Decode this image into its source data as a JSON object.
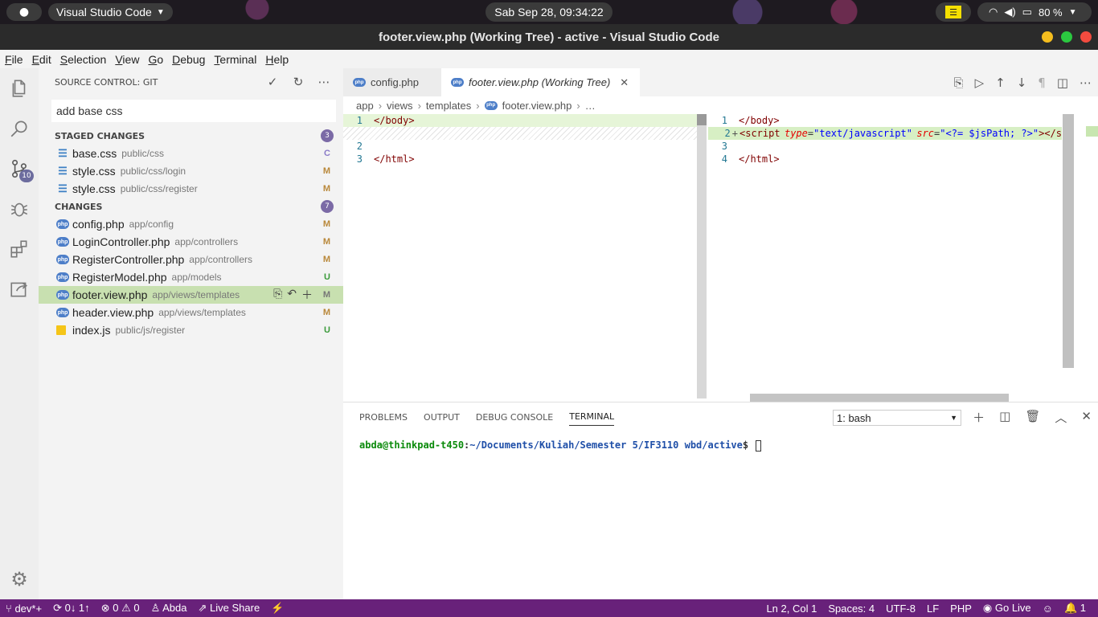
{
  "system": {
    "app_name": "Visual Studio Code",
    "clock": "Sab Sep 28, 09:34:22",
    "battery": "80 %"
  },
  "window": {
    "title": "footer.view.php (Working Tree) - active - Visual Studio Code"
  },
  "menu": [
    "File",
    "Edit",
    "Selection",
    "View",
    "Go",
    "Debug",
    "Terminal",
    "Help"
  ],
  "activity": {
    "scm_badge": "10"
  },
  "sidebar": {
    "title": "SOURCE CONTROL: GIT",
    "commit_message": "add base css",
    "staged_header": "STAGED CHANGES",
    "staged_count": "3",
    "staged": [
      {
        "name": "base.css",
        "path": "public/css",
        "status": "C",
        "icon": "css-icon"
      },
      {
        "name": "style.css",
        "path": "public/css/login",
        "status": "M",
        "icon": "css-icon"
      },
      {
        "name": "style.css",
        "path": "public/css/register",
        "status": "M",
        "icon": "css-icon"
      }
    ],
    "changes_header": "CHANGES",
    "changes_count": "7",
    "changes": [
      {
        "name": "config.php",
        "path": "app/config",
        "status": "M"
      },
      {
        "name": "LoginController.php",
        "path": "app/controllers",
        "status": "M"
      },
      {
        "name": "RegisterController.php",
        "path": "app/controllers",
        "status": "M"
      },
      {
        "name": "RegisterModel.php",
        "path": "app/models",
        "status": "U"
      },
      {
        "name": "footer.view.php",
        "path": "app/views/templates",
        "status": "M"
      },
      {
        "name": "header.view.php",
        "path": "app/views/templates",
        "status": "M"
      },
      {
        "name": "index.js",
        "path": "public/js/register",
        "status": "U"
      }
    ]
  },
  "tabs": [
    {
      "label": "config.php"
    },
    {
      "label": "footer.view.php (Working Tree)"
    }
  ],
  "breadcrumb": [
    "app",
    "views",
    "templates",
    "footer.view.php",
    "…"
  ],
  "diff": {
    "left": {
      "l1": "1",
      "l1_code": "</body>",
      "l2": "2",
      "l3": "3",
      "l3_code": "</html>"
    },
    "right": {
      "l1": "1",
      "l1_code": "</body>",
      "l2": "2",
      "l2_tag": "script",
      "l2_attr1": "type",
      "l2_val1": "\"text/javascript\"",
      "l2_attr2": "src",
      "l2_val2": "\"<?= $jsPath; ?>\"",
      "l2_tail": "></s",
      "l3": "3",
      "l4": "4",
      "l4_code": "</html>"
    }
  },
  "panel": {
    "tabs": [
      "PROBLEMS",
      "OUTPUT",
      "DEBUG CONSOLE",
      "TERMINAL"
    ],
    "terminal_select": "1: bash",
    "prompt_user": "abda@thinkpad-t450",
    "prompt_sep": ":",
    "prompt_path": "~/Documents/Kuliah/Semester 5/IF3110 wbd/active",
    "prompt_end": "$"
  },
  "status": {
    "branch": "dev*+",
    "sync": "0↓ 1↑",
    "errors": "0",
    "warnings": "0",
    "user": "Abda",
    "live_share": "Live Share",
    "position": "Ln 2, Col 1",
    "spaces": "Spaces: 4",
    "encoding": "UTF-8",
    "eol": "LF",
    "language": "PHP",
    "go_live": "Go Live",
    "notifications": "1"
  },
  "colors": {
    "status_bar": "#68217a",
    "scm_added_line": "#d7efc4",
    "selected_row": "#c8e0b0"
  }
}
